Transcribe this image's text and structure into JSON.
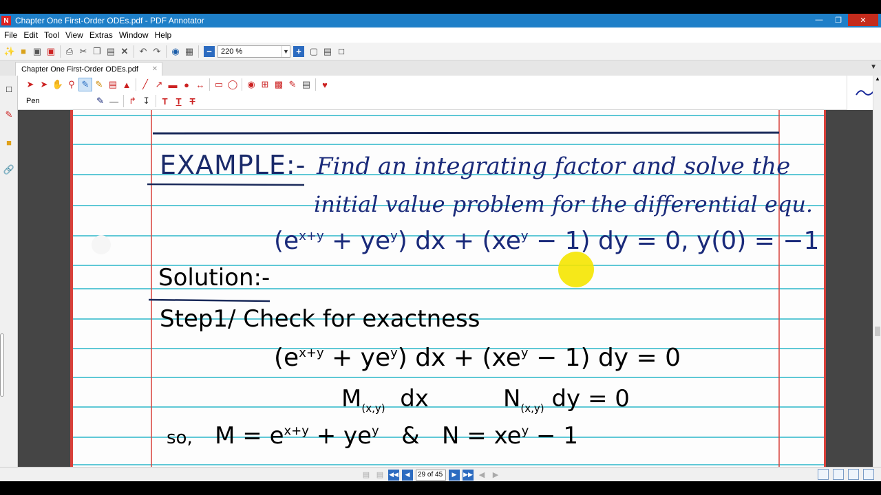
{
  "window": {
    "title": "Chapter One First-Order ODEs.pdf - PDF Annotator",
    "app_icon": "pdf-annotator-logo",
    "controls": [
      "minimize-icon",
      "restore-icon",
      "close-icon"
    ]
  },
  "menu": [
    "File",
    "Edit",
    "Tool",
    "View",
    "Extras",
    "Window",
    "Help"
  ],
  "toolbar": {
    "zoom_value": "220 %"
  },
  "tab": {
    "label": "Chapter One First-Order ODEs.pdf"
  },
  "annotation_toolbar": {
    "active_tool_label": "Pen"
  },
  "document": {
    "example_label": "EXAMPLE:-",
    "problem_line1": "Find an integrating factor and solve the",
    "problem_line2": "initial value problem for the differential equ.",
    "equation": "(e^{x+y} + ye^y) dx + (xe^y - 1) dy = 0, y(0) = -1 ?",
    "solution_label": "Solution:-",
    "step1": "Step1/ Check for exactness",
    "step1_eq": "(e^{x+y} + ye^y) dx + (xe^y - 1) dy = 0",
    "mn_line": "M(x,y) dx   N(x,y) dy = 0",
    "so_line": "so, M = e^{x+y} + ye^y & N = xe^y - 1"
  },
  "status": {
    "page_indicator": "29 of 45"
  },
  "colors": {
    "titlebar": "#1e7fc8",
    "ink": "#1a2a7a",
    "ruled_line": "#5fc8d6",
    "margin_red": "#d8403a",
    "highlight": "#f5e600"
  }
}
